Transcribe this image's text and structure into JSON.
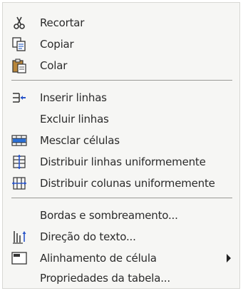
{
  "menu": {
    "items": [
      {
        "label": "Recortar",
        "icon": "scissors-icon"
      },
      {
        "label": "Copiar",
        "icon": "copy-icon"
      },
      {
        "label": "Colar",
        "icon": "paste-icon"
      },
      {
        "label": "Inserir linhas",
        "icon": "insert-rows-icon"
      },
      {
        "label": "Excluir linhas"
      },
      {
        "label": "Mesclar células",
        "icon": "merge-cells-icon"
      },
      {
        "label": "Distribuir linhas uniformemente",
        "icon": "distribute-rows-icon"
      },
      {
        "label": "Distribuir colunas uniformemente",
        "icon": "distribute-columns-icon"
      },
      {
        "label": "Bordas e sombreamento..."
      },
      {
        "label": "Direção do texto...",
        "icon": "text-direction-icon"
      },
      {
        "label": "Alinhamento de célula",
        "icon": "cell-alignment-icon",
        "has_submenu": true
      },
      {
        "label": "Propriedades da tabela..."
      }
    ]
  }
}
